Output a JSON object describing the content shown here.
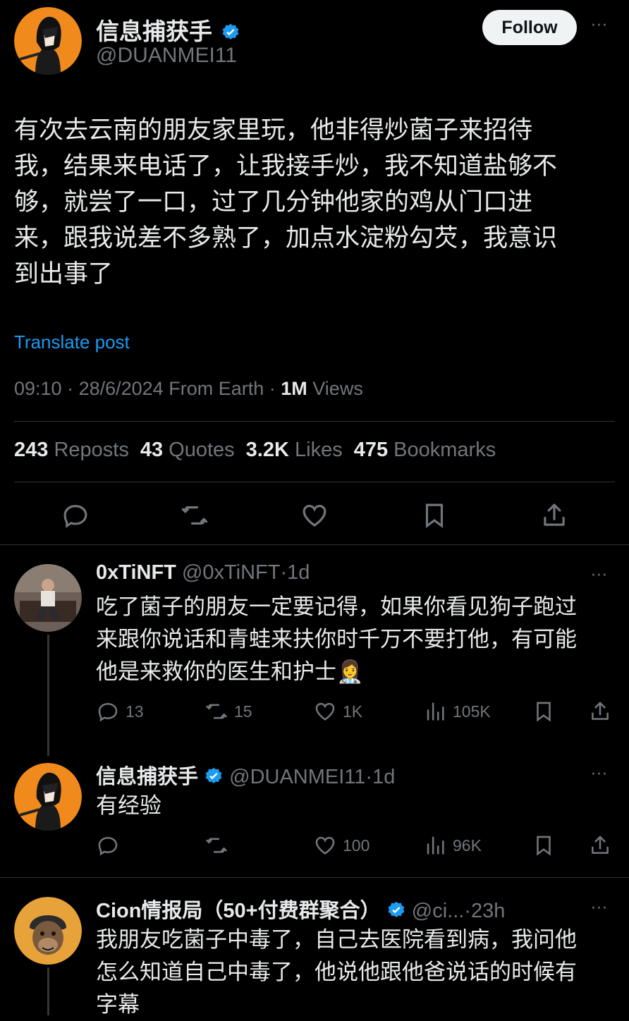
{
  "post": {
    "author_name": "信息捕获手",
    "author_handle": "@DUANMEI11",
    "follow_label": "Follow",
    "more": "···",
    "text_lines": [
      "有次去云南的朋友家里玩，他非得炒菌子来招待",
      "我，结果来电话了，让我接手炒，我不知道盐够不",
      "够，就尝了一口，过了几分钟他家的鸡从门口进",
      "来，跟我说差不多熟了，加点水淀粉勾芡，我意识",
      "到出事了"
    ],
    "translate_label": "Translate post",
    "time": "09:10",
    "date": "28/6/2024",
    "source": "From Earth",
    "views_count": "1M",
    "views_label": "Views",
    "stats": {
      "reposts_count": "243",
      "reposts_label": "Reposts",
      "quotes_count": "43",
      "quotes_label": "Quotes",
      "likes_count": "3.2K",
      "likes_label": "Likes",
      "bookmarks_count": "475",
      "bookmarks_label": "Bookmarks"
    }
  },
  "replies": [
    {
      "name": "0xTiNFT",
      "handle": "@0xTiNFT",
      "age": "1d",
      "lines": [
        "吃了菌子的朋友一定要记得，如果你看见狗子跑过",
        "来跟你说话和青蛙来扶你时千万不要打他，有可能",
        "他是来救你的医生和护士"
      ],
      "emoji": "👩‍⚕️",
      "replies": "13",
      "reposts": "15",
      "likes": "1K",
      "views": "105K"
    },
    {
      "name": "信息捕获手",
      "handle": "@DUANMEI11",
      "age": "1d",
      "lines": [
        "有经验"
      ],
      "likes": "100",
      "views": "96K"
    },
    {
      "name": "Cion情报局（50+付费群聚合）",
      "handle": "@ci...",
      "age": "23h",
      "lines": [
        "我朋友吃菌子中毒了，自己去医院看到病，我问他",
        "怎么知道自己中毒了，他说他跟他爸说话的时候有",
        "字幕"
      ]
    }
  ],
  "colors": {
    "accent": "#1d9bf0",
    "muted": "#71767b",
    "text": "#e7e9ea",
    "background": "#000000"
  }
}
